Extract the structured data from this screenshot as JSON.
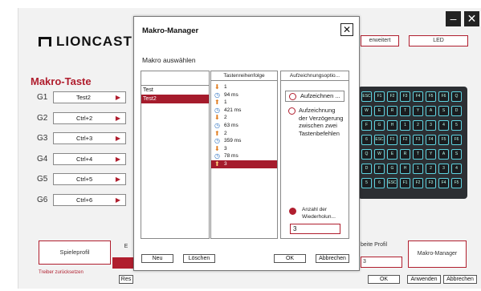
{
  "app": {
    "brand": "LIONCAST",
    "section_title": "Makro-Taste",
    "minimize_label": "–",
    "close_label": "✕",
    "top_buttons": {
      "advanced": "erweitert",
      "led": "LED"
    },
    "gkeys": [
      {
        "key": "G1",
        "value": "Test2"
      },
      {
        "key": "G2",
        "value": "Ctrl+2"
      },
      {
        "key": "G3",
        "value": "Ctrl+3"
      },
      {
        "key": "G4",
        "value": "Ctrl+4"
      },
      {
        "key": "G5",
        "value": "Ctrl+5"
      },
      {
        "key": "G6",
        "value": "Ctrl+6"
      }
    ],
    "bottom": {
      "game_profile": "Spieleprofil",
      "e_label": "E",
      "edit_profile": "beite Profil",
      "profile_value": "3",
      "macro_manager": "Makro-Manager",
      "reset_driver": "Treiber zurücksetzen",
      "res_label": "Res",
      "ok": "OK",
      "apply": "Anwenden",
      "cancel": "Abbrechen"
    }
  },
  "dialog": {
    "title": "Makro-Manager",
    "close_icon": "✕",
    "select_label": "Makro auswählen",
    "macro_list": [
      "Test",
      "Test2"
    ],
    "selected_macro": "Test2",
    "sequence_header": "Tastenreihenfolge",
    "sequence": [
      {
        "type": "down",
        "text": "1"
      },
      {
        "type": "delay",
        "text": "94 ms"
      },
      {
        "type": "up",
        "text": "1"
      },
      {
        "type": "delay",
        "text": "421 ms"
      },
      {
        "type": "down",
        "text": "2"
      },
      {
        "type": "delay",
        "text": "63 ms"
      },
      {
        "type": "up",
        "text": "2"
      },
      {
        "type": "delay",
        "text": "359 ms"
      },
      {
        "type": "down",
        "text": "3"
      },
      {
        "type": "delay",
        "text": "78 ms"
      },
      {
        "type": "up",
        "text": "3"
      }
    ],
    "options_header": "Aufzeichnungsoptio...",
    "record_button": "Aufzeichnen ...",
    "record_delay_text": [
      "Aufzeichnung",
      "der Verzögerung",
      "zwischen zwei",
      "Tastenbefehlen"
    ],
    "repeat_label": [
      "Anzahl der",
      "Wiederholun..."
    ],
    "repeat_value": "3",
    "new": "Neu",
    "delete": "Löschen",
    "ok": "OK",
    "cancel": "Abbrechen"
  },
  "keyboard_keys": [
    "ESC",
    "F1",
    "F2",
    "F3",
    "F4",
    "F5",
    "F6",
    "Q",
    "W",
    "E",
    "R",
    "T",
    "Y",
    "A",
    "S",
    "D",
    "F",
    "G",
    "H",
    "1",
    "2",
    "3",
    "4",
    "5",
    "6"
  ],
  "colors": {
    "accent": "#b01e2e",
    "selection": "#a51b2c",
    "keyboard_glow": "#5fd3e0"
  }
}
